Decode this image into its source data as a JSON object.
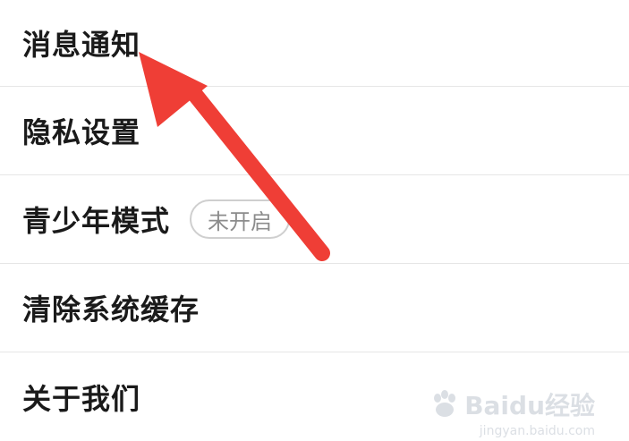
{
  "settings": {
    "items": [
      {
        "label": "消息通知"
      },
      {
        "label": "隐私设置"
      },
      {
        "label": "青少年模式",
        "badge": "未开启"
      },
      {
        "label": "清除系统缓存"
      },
      {
        "label": "关于我们"
      }
    ]
  },
  "annotation": {
    "arrow_color": "#ef3e36"
  },
  "watermark": {
    "brand": "Baidu经验",
    "url": "jingyan.baidu.com"
  }
}
